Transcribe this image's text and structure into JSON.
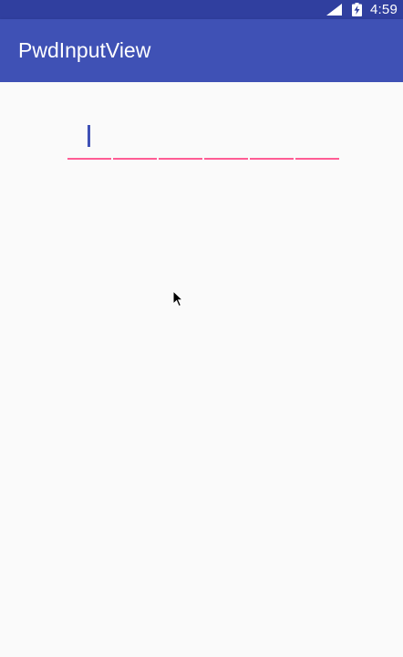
{
  "status_bar": {
    "time": "4:59",
    "icons": [
      "cell-signal-icon",
      "battery-charging-icon"
    ],
    "background": "#303f9f"
  },
  "app_bar": {
    "title": "PwdInputView",
    "background": "#3f51b5"
  },
  "pwd_input": {
    "length": 6,
    "active_index": 0,
    "underline_color": "#ff4081",
    "caret_color": "#3f51b5"
  },
  "colors": {
    "primary": "#3f51b5",
    "primary_dark": "#303f9f",
    "accent": "#ff4081",
    "background": "#fafafa"
  }
}
